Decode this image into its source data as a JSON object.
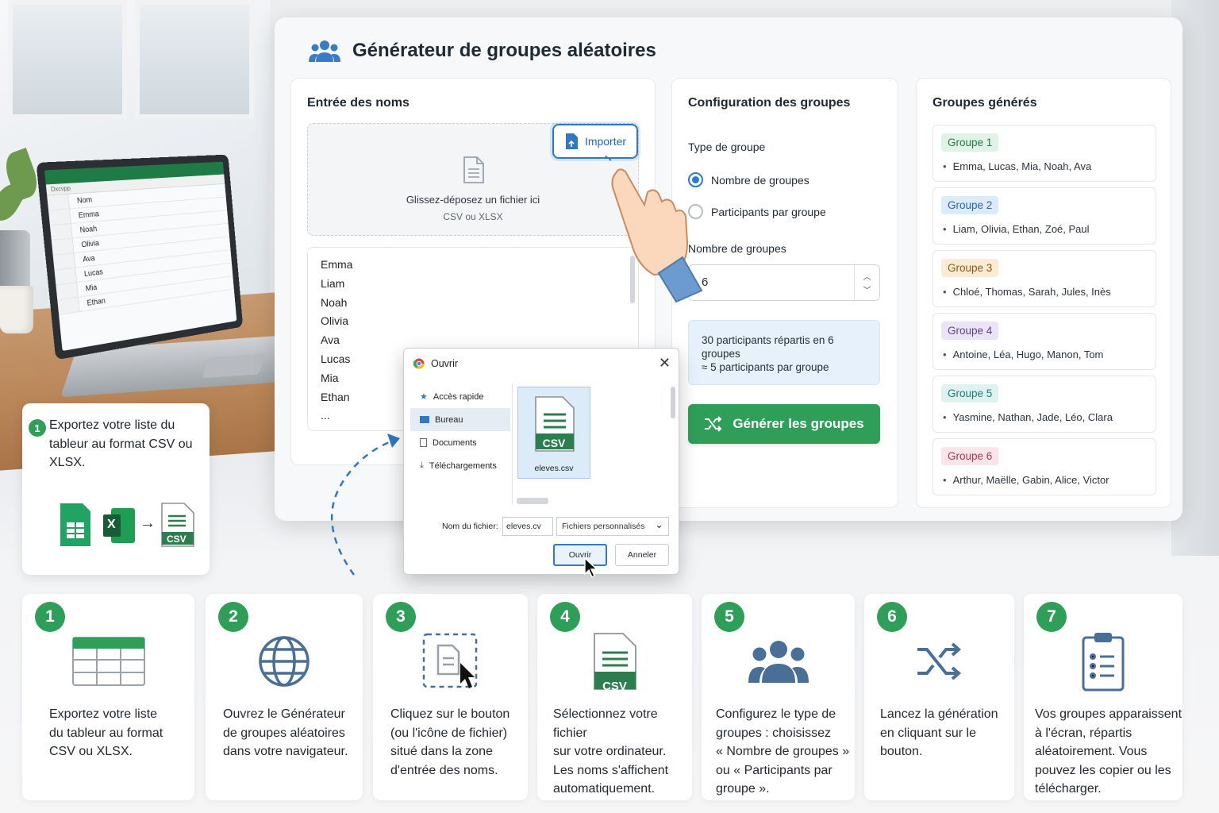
{
  "app": {
    "title": "Générateur de groupes aléatoires"
  },
  "entry": {
    "title": "Entrée des noms",
    "import_label": "Importer",
    "drop_text": "Glissez-déposez un fichier ici",
    "drop_sub": "CSV ou XLSX",
    "names": [
      "Emma",
      "Liam",
      "Noah",
      "Olivia",
      "Ava",
      "Lucas",
      "Mia",
      "Ethan",
      "..."
    ]
  },
  "config": {
    "title": "Configuration des groupes",
    "type_label": "Type de groupe",
    "options": [
      {
        "label": "Nombre de groupes",
        "selected": true
      },
      {
        "label": "Participants par groupe",
        "selected": false
      }
    ],
    "count_label": "Nombre de groupes",
    "count_value": "6",
    "summary_line1": "30 participants répartis en 6 groupes",
    "summary_line2": "≈ 5 participants par groupe",
    "generate_label": "Générer les groupes"
  },
  "groups": {
    "title": "Groupes générés",
    "items": [
      {
        "name": "Groupe 1",
        "members": "Emma, Lucas, Mia, Noah, Ava",
        "bg": "#e1f3e6",
        "fg": "#1e7b45"
      },
      {
        "name": "Groupe 2",
        "members": "Liam, Olivia, Ethan, Zoé, Paul",
        "bg": "#dcebfa",
        "fg": "#2766ad"
      },
      {
        "name": "Groupe 3",
        "members": "Chloé, Thomas, Sarah, Jules, Inès",
        "bg": "#fcebd4",
        "fg": "#8a5a14"
      },
      {
        "name": "Groupe 4",
        "members": "Antoine, Léa, Hugo, Manon, Tom",
        "bg": "#ebe4f7",
        "fg": "#5b3f94"
      },
      {
        "name": "Groupe 5",
        "members": "Yasmine, Nathan, Jade, Léo, Clara",
        "bg": "#dff2f1",
        "fg": "#1c7a73"
      },
      {
        "name": "Groupe 6",
        "members": "Arthur, Maëlle, Gabin, Alice, Victor",
        "bg": "#fbe4ea",
        "fg": "#a33a55"
      }
    ]
  },
  "laptop": {
    "toolbar": "Dxcvpp",
    "rows": [
      "Nom",
      "Emma",
      "Noah",
      "Olivia",
      "Ava",
      "Lucas",
      "Mia",
      "Ethan"
    ]
  },
  "callout": {
    "number": "1",
    "text": "Exportez votre liste du tableur au format CSV ou XLSX.",
    "csv_label": "CSV",
    "excel_label": "X"
  },
  "dialog": {
    "title": "Ouvrir",
    "nav": [
      "Accès rapide",
      "Bureau",
      "Documents",
      "Téléchargements"
    ],
    "file_name": "eleves.csv",
    "file_type": "CSV",
    "filename_label": "Nom du fichier:",
    "filename_value": "eleves.cv",
    "filter": "Fichiers personnalisés",
    "open_label": "Ouvrir",
    "cancel_label": "Anneler"
  },
  "steps": [
    {
      "n": "1",
      "text": [
        "Exportez votre liste",
        "du tableur au format",
        "CSV ou XLSX."
      ]
    },
    {
      "n": "2",
      "text": [
        "Ouvrez le Générateur",
        "de groupes aléatoires",
        "dans votre navigateur."
      ]
    },
    {
      "n": "3",
      "text": [
        "Cliquez sur le bouton",
        "(ou l'icône de fichier)",
        "situé dans la zone",
        "d'entrée des noms."
      ]
    },
    {
      "n": "4",
      "text": [
        "Sélectionnez votre fichier",
        "sur votre ordinateur.",
        "Les noms s'affichent",
        "automatiquement."
      ],
      "badge": "CSV"
    },
    {
      "n": "5",
      "text": [
        "Configurez le type de",
        "groupes : choisissez",
        "« Nombre de groupes »",
        "ou « Participants par",
        "groupe »."
      ]
    },
    {
      "n": "6",
      "text": [
        "Lancez la génération",
        "en cliquant sur le",
        "bouton."
      ]
    },
    {
      "n": "7",
      "text": [
        "Vos groupes apparaissent",
        "à l'écran, répartis",
        "aléatoirement. Vous",
        "pouvez les copier ou les",
        "télécharger."
      ]
    }
  ],
  "colors": {
    "accent_green": "#2e9e58",
    "accent_blue": "#2f78c4"
  }
}
